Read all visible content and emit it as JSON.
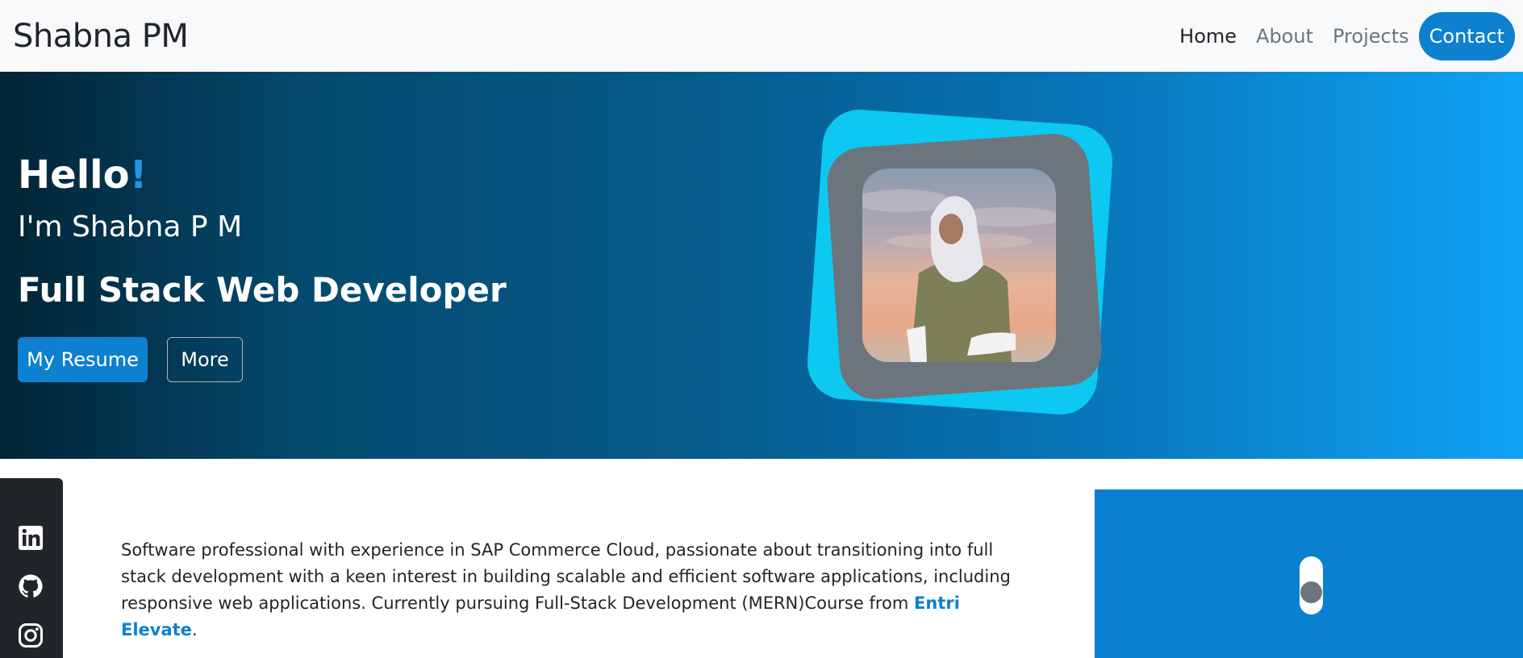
{
  "navbar": {
    "brand": "Shabna PM",
    "links": [
      {
        "label": "Home"
      },
      {
        "label": "About"
      },
      {
        "label": "Projects"
      },
      {
        "label": "Contact"
      }
    ]
  },
  "hero": {
    "greeting": "Hello",
    "greeting_punct": "!",
    "intro": "I'm Shabna P M",
    "role": "Full Stack Web Developer",
    "primary_button": "My Resume",
    "secondary_button": "More"
  },
  "social": {
    "icons": [
      "linkedin-icon",
      "github-icon",
      "instagram-icon"
    ]
  },
  "about": {
    "text": "Software professional with experience in SAP Commerce Cloud, passionate about transitioning into full stack development with a keen interest in building scalable and efficient software applications, including responsive web applications. Currently pursuing Full-Stack Development (MERN)Course from ",
    "link": "Entri Elevate",
    "tail": "."
  },
  "colors": {
    "accent": "#0d80d0",
    "frame_outer": "#0dc8f0",
    "frame_inner": "#6c757d",
    "sidebar": "#212529"
  }
}
